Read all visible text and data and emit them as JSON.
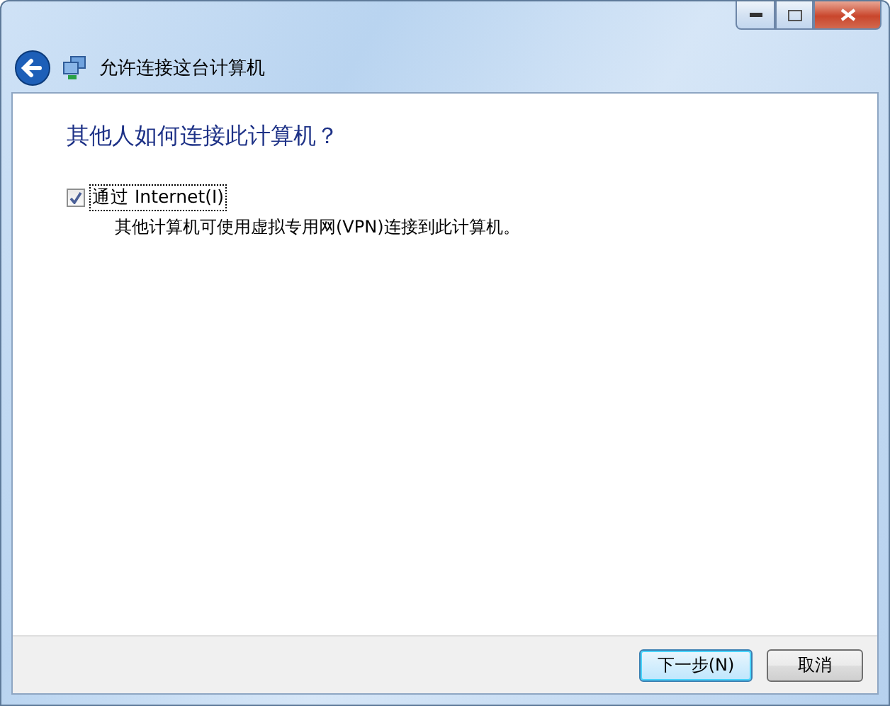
{
  "window": {
    "title": "允许连接这台计算机"
  },
  "heading": "其他人如何连接此计算机？",
  "options": [
    {
      "label": "通过 Internet(I)",
      "checked": true,
      "focused": true,
      "description": "其他计算机可使用虚拟专用网(VPN)连接到此计算机。"
    }
  ],
  "buttons": [
    {
      "label": "下一步(N)",
      "kind": "default"
    },
    {
      "label": "取消",
      "kind": "normal"
    }
  ]
}
